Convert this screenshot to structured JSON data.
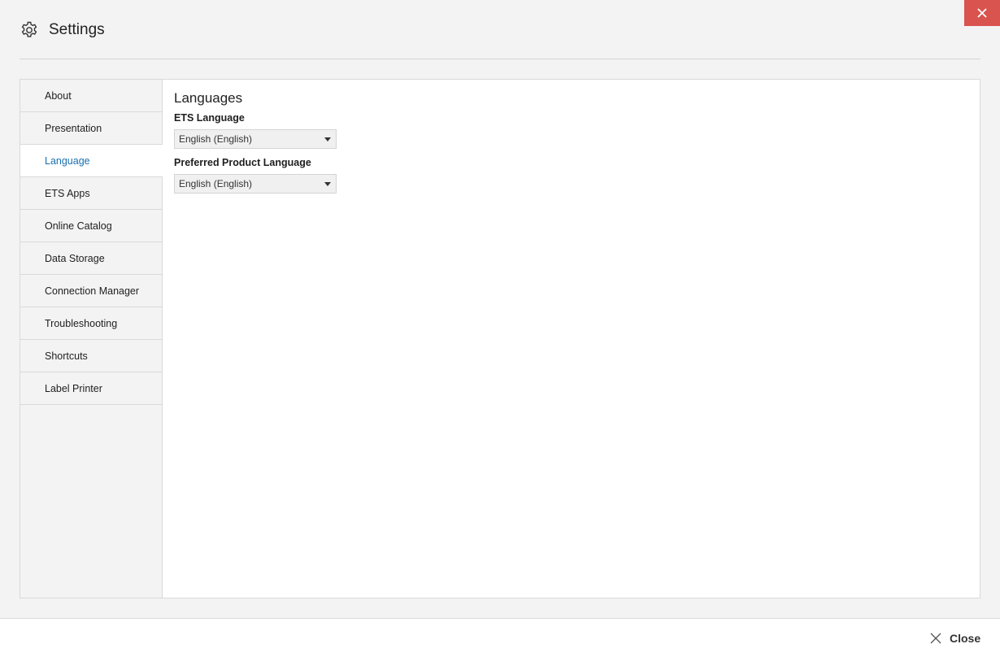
{
  "window": {
    "title": "Settings",
    "close_icon": "close-icon",
    "settings_icon": "gear-icon",
    "accent_close": "#d9534f",
    "accent_active": "#1a6fb0"
  },
  "sidebar": {
    "items": [
      {
        "label": "About",
        "active": false
      },
      {
        "label": "Presentation",
        "active": false
      },
      {
        "label": "Language",
        "active": true
      },
      {
        "label": "ETS Apps",
        "active": false
      },
      {
        "label": "Online Catalog",
        "active": false
      },
      {
        "label": "Data Storage",
        "active": false
      },
      {
        "label": "Connection Manager",
        "active": false
      },
      {
        "label": "Troubleshooting",
        "active": false
      },
      {
        "label": "Shortcuts",
        "active": false
      },
      {
        "label": "Label Printer",
        "active": false
      }
    ]
  },
  "main": {
    "section_title": "Languages",
    "fields": [
      {
        "label": "ETS Language",
        "value": "English (English)"
      },
      {
        "label": "Preferred Product Language",
        "value": "English (English)"
      }
    ]
  },
  "footer": {
    "close_label": "Close"
  }
}
